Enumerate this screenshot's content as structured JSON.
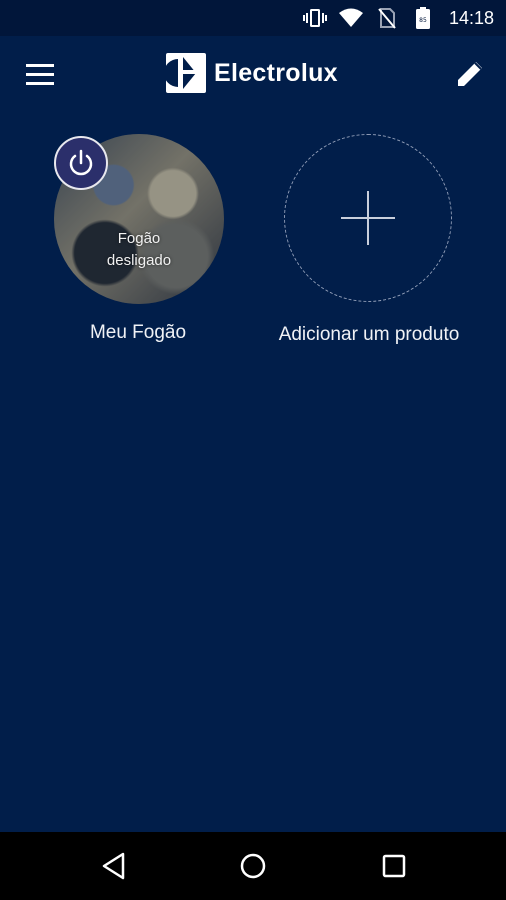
{
  "status_bar": {
    "time": "14:18",
    "icons": [
      "vibrate-icon",
      "wifi-icon",
      "no-sim-icon",
      "battery-icon"
    ]
  },
  "app_bar": {
    "brand": "Electrolux",
    "menu_icon": "hamburger-menu-icon",
    "edit_icon": "pencil-icon"
  },
  "products": [
    {
      "name": "Meu Fogão",
      "status_line1": "Fogão",
      "status_line2": "desligado",
      "power_icon": "power-icon"
    }
  ],
  "add_product": {
    "label": "Adicionar um produto",
    "icon": "plus-icon"
  },
  "nav_bar": {
    "icons": [
      "back-triangle-icon",
      "home-circle-icon",
      "recents-square-icon"
    ]
  },
  "colors": {
    "background": "#011e4a",
    "status_bar": "#01163a",
    "nav_bar": "#000000",
    "power_button": "#2b2f6b"
  }
}
